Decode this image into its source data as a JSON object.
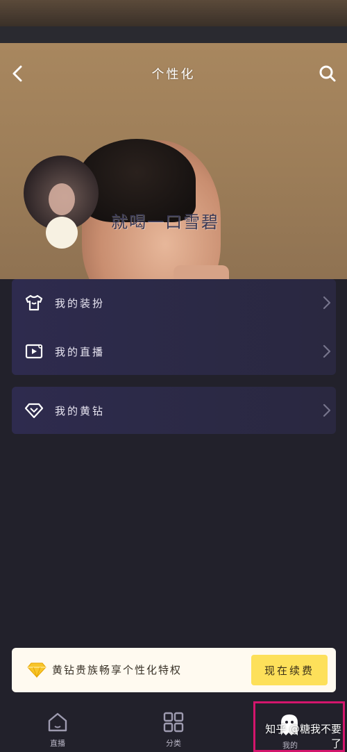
{
  "header": {
    "title": "个性化",
    "back_icon": "back-arrow-icon",
    "search_icon": "search-icon"
  },
  "profile": {
    "username": "就喝一口雪碧"
  },
  "menu_group_1": {
    "items": [
      {
        "label": "我的装扮",
        "icon": "shirt-icon"
      },
      {
        "label": "我的直播",
        "icon": "live-stream-icon"
      }
    ]
  },
  "menu_group_2": {
    "items": [
      {
        "label": "我的黄钻",
        "icon": "diamond-icon"
      }
    ]
  },
  "promo": {
    "text": "黄钻贵族畅享个性化特权",
    "button": "现在续费",
    "accent": "#fde05a"
  },
  "tabbar": {
    "tabs": [
      {
        "label": "直播",
        "icon": "home-icon"
      },
      {
        "label": "分类",
        "icon": "grid-icon"
      },
      {
        "label": "我的",
        "icon": "ghost-icon"
      }
    ]
  },
  "watermark": "知乎 @糖我不要了"
}
